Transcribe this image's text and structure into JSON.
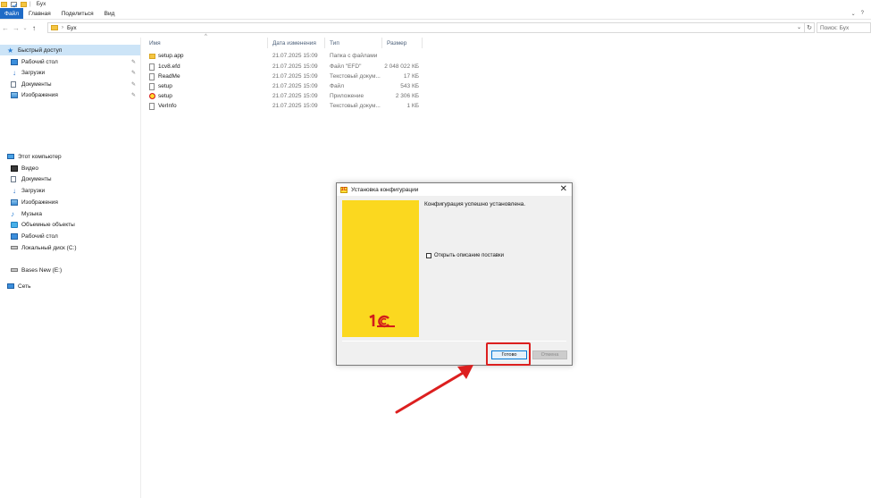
{
  "window": {
    "title": "Бух",
    "sep": "|"
  },
  "ribbon": {
    "tabs": [
      "Файл",
      "Главная",
      "Поделиться",
      "Вид"
    ],
    "help": "?",
    "chevron": "⌄"
  },
  "address": {
    "chevron": "›",
    "path": "Бух",
    "dropdown": "⌄",
    "refresh": "↻",
    "search_placeholder": "Поиск: Бух"
  },
  "nav_buttons": {
    "back": "←",
    "forward": "→",
    "recent": "⌄",
    "up": "↑"
  },
  "sidebar": {
    "quick_access": "Быстрый доступ",
    "pinned": [
      "Рабочий стол",
      "Загрузки",
      "Документы",
      "Изображения"
    ],
    "this_pc": "Этот компьютер",
    "pc_items": [
      "Видео",
      "Документы",
      "Загрузки",
      "Изображения",
      "Музыка",
      "Объемные объекты",
      "Рабочий стол",
      "Локальный диск (C:)"
    ],
    "drive": "Bases New (E:)",
    "network": "Сеть",
    "pin_icon": "✎"
  },
  "files": {
    "columns": {
      "name": "Имя",
      "date": "Дата изменения",
      "type": "Тип",
      "size": "Размер"
    },
    "sort_indicator": "^",
    "rows": [
      {
        "name": "setup.app",
        "date": "21.07.2025 15:09",
        "type": "Папка с файлами",
        "size": "",
        "icon": "folder-icon"
      },
      {
        "name": "1cv8.efd",
        "date": "21.07.2025 15:09",
        "type": "Файл \"EFD\"",
        "size": "2 048 022 КБ",
        "icon": "file-icon"
      },
      {
        "name": "ReadMe",
        "date": "21.07.2025 15:09",
        "type": "Текстовый докум...",
        "size": "17 КБ",
        "icon": "file-icon"
      },
      {
        "name": "setup",
        "date": "21.07.2025 15:09",
        "type": "Файл",
        "size": "543 КБ",
        "icon": "file-icon"
      },
      {
        "name": "setup",
        "date": "21.07.2025 15:09",
        "type": "Приложение",
        "size": "2 306 КБ",
        "icon": "app-icon"
      },
      {
        "name": "VerInfo",
        "date": "21.07.2025 15:09",
        "type": "Текстовый докум...",
        "size": "1 КБ",
        "icon": "file-icon"
      }
    ]
  },
  "dialog": {
    "title": "Установка конфигурации",
    "close": "✕",
    "logo_text": "1С",
    "message": "Конфигурация успешно установлена.",
    "checkbox_label": "Открыть описание поставки",
    "checkbox_checked": false,
    "ok_button": "Готово",
    "cancel_button": "Отмена"
  },
  "colors": {
    "accent": "#1f6bc6",
    "banner_yellow": "#fbd81f",
    "logo_red": "#d21b1b",
    "highlight_red": "#dc1f1f",
    "selected_nav": "#cce4f7"
  }
}
